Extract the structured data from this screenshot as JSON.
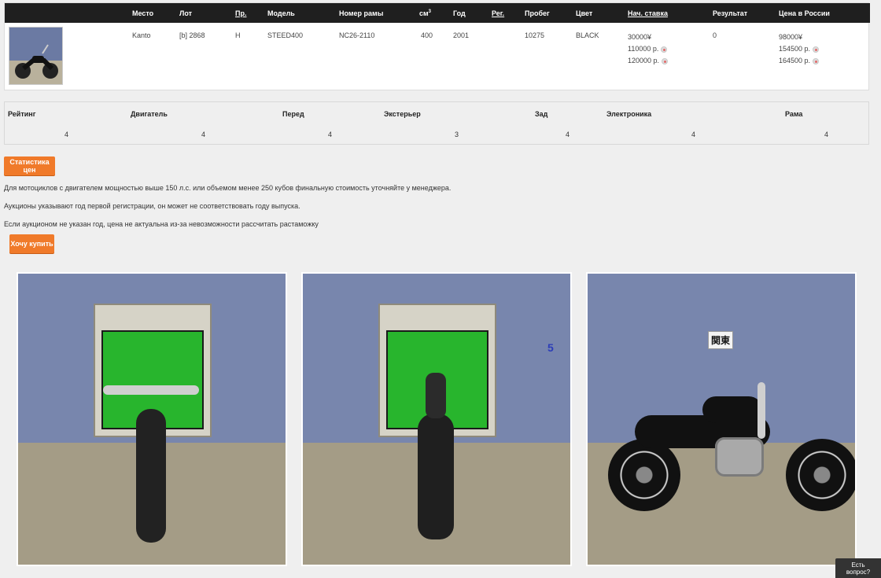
{
  "lot_table": {
    "headers": {
      "place": "Место",
      "lot": "Лот",
      "pr": "Пр.",
      "model": "Модель",
      "frame": "Номер рамы",
      "cc": "см",
      "cc_sup": "3",
      "year": "Год",
      "reg": "Рег.",
      "mileage": "Пробег",
      "color": "Цвет",
      "start_bid": "Нач. ставка",
      "result": "Результат",
      "price_russia": "Цена в России"
    },
    "row": {
      "place": "Kanto",
      "lot": "[b] 2868",
      "pr": "H",
      "model": "STEED400",
      "frame": "NC26-2110",
      "cc": "400",
      "year": "2001",
      "reg": "",
      "mileage": "10275",
      "color": "BLACK",
      "start_bid_yen": "30000¥",
      "start_bid_rub_1": "110000 р.",
      "start_bid_rub_2": "120000 р.",
      "result": "0",
      "price_yen": "98000¥",
      "price_rub_1": "154500 р.",
      "price_rub_2": "164500 р."
    }
  },
  "ratings": {
    "headers": [
      "Рейтинг",
      "Двигатель",
      "Перед",
      "Экстерьер",
      "Зад",
      "Электроника",
      "Рама"
    ],
    "values": [
      "4",
      "4",
      "4",
      "3",
      "4",
      "4",
      "4"
    ]
  },
  "buttons": {
    "price_stats": "Статистика цен",
    "want_buy": "Хочу купить",
    "chat": "Есть вопрос?"
  },
  "notes": [
    "Для мотоциклов с двигателем мощностью выше 150 л.с. или объемом менее 250 кубов финальную стоимость уточняйте у менеджера.",
    "Аукционы указывают год первой регистрации, он может не соответствовать году выпуска.",
    "Если аукционом не указан год, цена не актуальна из-за невозможности рассчитать растаможку"
  ],
  "photos": {
    "photo2_number": "5",
    "photo3_sign": "関東"
  }
}
